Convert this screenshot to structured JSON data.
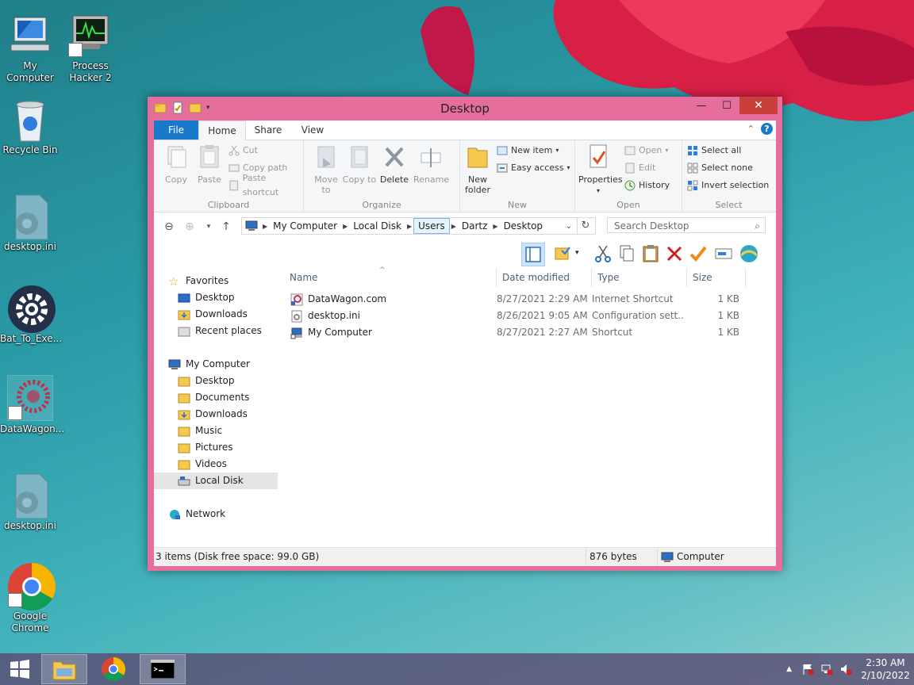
{
  "desktop": {
    "icons": [
      {
        "label": "My Computer"
      },
      {
        "label": "Process Hacker 2"
      },
      {
        "label": "Recycle Bin"
      },
      {
        "label": "desktop.ini"
      },
      {
        "label": "Bat_To_Exe..."
      },
      {
        "label": "DataWagon..."
      },
      {
        "label": "desktop.ini"
      },
      {
        "label": "Google Chrome"
      }
    ]
  },
  "window": {
    "title": "Desktop",
    "controls": {
      "minimize": "—",
      "maximize": "☐",
      "close": "✕"
    }
  },
  "ribbon": {
    "tabs": {
      "file": "File",
      "home": "Home",
      "share": "Share",
      "view": "View"
    },
    "help": "?",
    "clipboard": {
      "copy": "Copy",
      "paste": "Paste",
      "cut": "Cut",
      "copy_path": "Copy path",
      "paste_shortcut": "Paste shortcut",
      "label": "Clipboard"
    },
    "organize": {
      "move_to": "Move to",
      "copy_to": "Copy to",
      "delete": "Delete",
      "rename": "Rename",
      "label": "Organize"
    },
    "new": {
      "new_folder": "New folder",
      "new_item": "New item",
      "easy_access": "Easy access",
      "label": "New"
    },
    "open": {
      "properties": "Properties",
      "open": "Open",
      "edit": "Edit",
      "history": "History",
      "label": "Open"
    },
    "select": {
      "select_all": "Select all",
      "select_none": "Select none",
      "invert": "Invert selection",
      "label": "Select"
    }
  },
  "address": {
    "crumbs": [
      "My Computer",
      "Local Disk",
      "Users",
      "Dartz",
      "Desktop"
    ],
    "search_placeholder": "Search Desktop"
  },
  "navpane": {
    "favorites": "Favorites",
    "favorites_items": [
      "Desktop",
      "Downloads",
      "Recent places"
    ],
    "computer": "My Computer",
    "computer_items": [
      "Desktop",
      "Documents",
      "Downloads",
      "Music",
      "Pictures",
      "Videos",
      "Local Disk"
    ],
    "network": "Network"
  },
  "columns": {
    "name": "Name",
    "date": "Date modified",
    "type": "Type",
    "size": "Size"
  },
  "files": [
    {
      "name": "DataWagon.com",
      "date": "8/27/2021 2:29 AM",
      "type": "Internet Shortcut",
      "size": "1 KB"
    },
    {
      "name": "desktop.ini",
      "date": "8/26/2021 9:05 AM",
      "type": "Configuration sett...",
      "size": "1 KB"
    },
    {
      "name": "My Computer",
      "date": "8/27/2021 2:27 AM",
      "type": "Shortcut",
      "size": "1 KB"
    }
  ],
  "status": {
    "items": "3 items (Disk free space: 99.0 GB)",
    "bytes": "876 bytes",
    "location": "Computer"
  },
  "taskbar": {
    "time": "2:30 AM",
    "date": "2/10/2022"
  },
  "colors": {
    "accent": "#1979ca",
    "window_border": "#e56e9c",
    "close": "#c9403a"
  }
}
